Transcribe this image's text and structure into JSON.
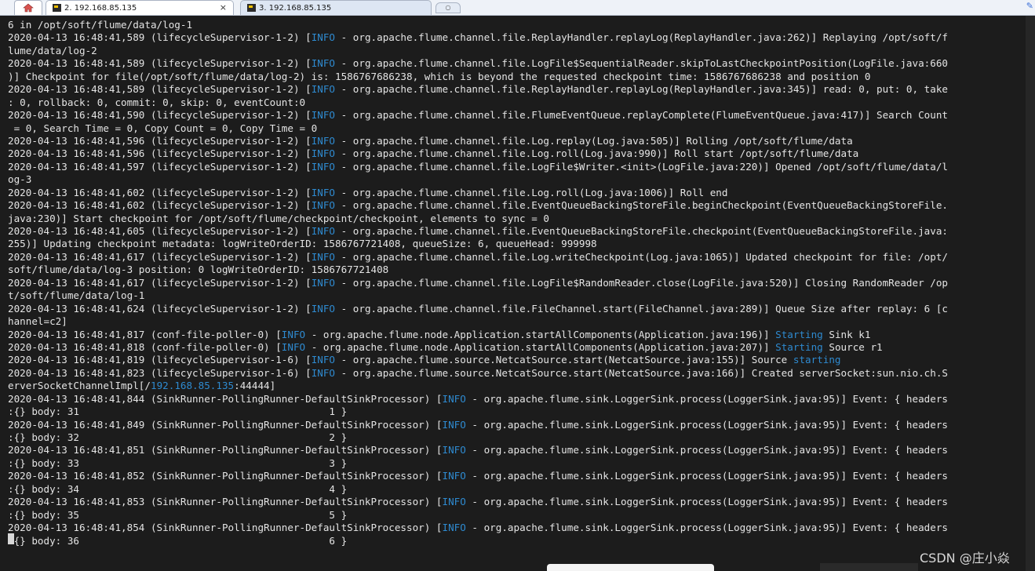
{
  "tabs": [
    {
      "label": "2. 192.168.85.135",
      "close": "×",
      "active": true
    },
    {
      "label": "3. 192.168.85.135",
      "active": false
    }
  ],
  "new_tab_label": "○",
  "icons": {
    "home": "home-icon",
    "session": "terminal-session-icon",
    "corner": "pin-icon"
  },
  "colors": {
    "background": "#1c1c1c",
    "text": "#e4e4e4",
    "highlight": "#2e8ad0"
  },
  "terminal_lines": [
    [
      {
        "t": "6 in /opt/soft/flume/data/log-1"
      }
    ],
    [
      {
        "t": "2020-04-13 16:48:41,589 (lifecycleSupervisor-1-2) ["
      },
      {
        "t": "INFO",
        "c": "hl"
      },
      {
        "t": " - org.apache.flume.channel.file.ReplayHandler.replayLog(ReplayHandler.java:262)] Replaying /opt/soft/f"
      }
    ],
    [
      {
        "t": "lume/data/log-2"
      }
    ],
    [
      {
        "t": "2020-04-13 16:48:41,589 (lifecycleSupervisor-1-2) ["
      },
      {
        "t": "INFO",
        "c": "hl"
      },
      {
        "t": " - org.apache.flume.channel.file.LogFile$SequentialReader.skipToLastCheckpointPosition(LogFile.java:660"
      }
    ],
    [
      {
        "t": ")] Checkpoint for file(/opt/soft/flume/data/log-2) is: 1586767686238, which is beyond the requested checkpoint time: 1586767686238 and position 0"
      }
    ],
    [
      {
        "t": "2020-04-13 16:48:41,589 (lifecycleSupervisor-1-2) ["
      },
      {
        "t": "INFO",
        "c": "hl"
      },
      {
        "t": " - org.apache.flume.channel.file.ReplayHandler.replayLog(ReplayHandler.java:345)] read: 0, put: 0, take"
      }
    ],
    [
      {
        "t": ": 0, rollback: 0, commit: 0, skip: 0, eventCount:0"
      }
    ],
    [
      {
        "t": "2020-04-13 16:48:41,590 (lifecycleSupervisor-1-2) ["
      },
      {
        "t": "INFO",
        "c": "hl"
      },
      {
        "t": " - org.apache.flume.channel.file.FlumeEventQueue.replayComplete(FlumeEventQueue.java:417)] Search Count"
      }
    ],
    [
      {
        "t": " = 0, Search Time = 0, Copy Count = 0, Copy Time = 0"
      }
    ],
    [
      {
        "t": "2020-04-13 16:48:41,596 (lifecycleSupervisor-1-2) ["
      },
      {
        "t": "INFO",
        "c": "hl"
      },
      {
        "t": " - org.apache.flume.channel.file.Log.replay(Log.java:505)] Rolling /opt/soft/flume/data"
      }
    ],
    [
      {
        "t": "2020-04-13 16:48:41,596 (lifecycleSupervisor-1-2) ["
      },
      {
        "t": "INFO",
        "c": "hl"
      },
      {
        "t": " - org.apache.flume.channel.file.Log.roll(Log.java:990)] Roll start /opt/soft/flume/data"
      }
    ],
    [
      {
        "t": "2020-04-13 16:48:41,597 (lifecycleSupervisor-1-2) ["
      },
      {
        "t": "INFO",
        "c": "hl"
      },
      {
        "t": " - org.apache.flume.channel.file.LogFile$Writer.<init>(LogFile.java:220)] Opened /opt/soft/flume/data/l"
      }
    ],
    [
      {
        "t": "og-3"
      }
    ],
    [
      {
        "t": "2020-04-13 16:48:41,602 (lifecycleSupervisor-1-2) ["
      },
      {
        "t": "INFO",
        "c": "hl"
      },
      {
        "t": " - org.apache.flume.channel.file.Log.roll(Log.java:1006)] Roll end"
      }
    ],
    [
      {
        "t": "2020-04-13 16:48:41,602 (lifecycleSupervisor-1-2) ["
      },
      {
        "t": "INFO",
        "c": "hl"
      },
      {
        "t": " - org.apache.flume.channel.file.EventQueueBackingStoreFile.beginCheckpoint(EventQueueBackingStoreFile."
      }
    ],
    [
      {
        "t": "java:230)] Start checkpoint for /opt/soft/flume/checkpoint/checkpoint, elements to sync = 0"
      }
    ],
    [
      {
        "t": "2020-04-13 16:48:41,605 (lifecycleSupervisor-1-2) ["
      },
      {
        "t": "INFO",
        "c": "hl"
      },
      {
        "t": " - org.apache.flume.channel.file.EventQueueBackingStoreFile.checkpoint(EventQueueBackingStoreFile.java:"
      }
    ],
    [
      {
        "t": "255)] Updating checkpoint metadata: logWriteOrderID: 1586767721408, queueSize: 6, queueHead: 999998"
      }
    ],
    [
      {
        "t": "2020-04-13 16:48:41,617 (lifecycleSupervisor-1-2) ["
      },
      {
        "t": "INFO",
        "c": "hl"
      },
      {
        "t": " - org.apache.flume.channel.file.Log.writeCheckpoint(Log.java:1065)] Updated checkpoint for file: /opt/"
      }
    ],
    [
      {
        "t": "soft/flume/data/log-3 position: 0 logWriteOrderID: 1586767721408"
      }
    ],
    [
      {
        "t": "2020-04-13 16:48:41,617 (lifecycleSupervisor-1-2) ["
      },
      {
        "t": "INFO",
        "c": "hl"
      },
      {
        "t": " - org.apache.flume.channel.file.LogFile$RandomReader.close(LogFile.java:520)] Closing RandomReader /op"
      }
    ],
    [
      {
        "t": "t/soft/flume/data/log-1"
      }
    ],
    [
      {
        "t": "2020-04-13 16:48:41,624 (lifecycleSupervisor-1-2) ["
      },
      {
        "t": "INFO",
        "c": "hl"
      },
      {
        "t": " - org.apache.flume.channel.file.FileChannel.start(FileChannel.java:289)] Queue Size after replay: 6 [c"
      }
    ],
    [
      {
        "t": "hannel=c2]"
      }
    ],
    [
      {
        "t": "2020-04-13 16:48:41,817 (conf-file-poller-0) ["
      },
      {
        "t": "INFO",
        "c": "hl"
      },
      {
        "t": " - org.apache.flume.node.Application.startAllComponents(Application.java:196)] "
      },
      {
        "t": "Starting",
        "c": "hl"
      },
      {
        "t": " Sink k1"
      }
    ],
    [
      {
        "t": "2020-04-13 16:48:41,818 (conf-file-poller-0) ["
      },
      {
        "t": "INFO",
        "c": "hl"
      },
      {
        "t": " - org.apache.flume.node.Application.startAllComponents(Application.java:207)] "
      },
      {
        "t": "Starting",
        "c": "hl"
      },
      {
        "t": " Source r1"
      }
    ],
    [
      {
        "t": "2020-04-13 16:48:41,819 (lifecycleSupervisor-1-6) ["
      },
      {
        "t": "INFO",
        "c": "hl"
      },
      {
        "t": " - org.apache.flume.source.NetcatSource.start(NetcatSource.java:155)] Source "
      },
      {
        "t": "starting",
        "c": "hl"
      }
    ],
    [
      {
        "t": "2020-04-13 16:48:41,823 (lifecycleSupervisor-1-6) ["
      },
      {
        "t": "INFO",
        "c": "hl"
      },
      {
        "t": " - org.apache.flume.source.NetcatSource.start(NetcatSource.java:166)] Created serverSocket:sun.nio.ch.S"
      }
    ],
    [
      {
        "t": "erverSocketChannelImpl[/"
      },
      {
        "t": "192.168.85.135",
        "c": "hl"
      },
      {
        "t": ":44444]"
      }
    ],
    [
      {
        "t": "2020-04-13 16:48:41,844 (SinkRunner-PollingRunner-DefaultSinkProcessor) ["
      },
      {
        "t": "INFO",
        "c": "hl"
      },
      {
        "t": " - org.apache.flume.sink.LoggerSink.process(LoggerSink.java:95)] Event: { headers"
      }
    ],
    [
      {
        "t": ":{} body: 31                                          1 }"
      }
    ],
    [
      {
        "t": "2020-04-13 16:48:41,849 (SinkRunner-PollingRunner-DefaultSinkProcessor) ["
      },
      {
        "t": "INFO",
        "c": "hl"
      },
      {
        "t": " - org.apache.flume.sink.LoggerSink.process(LoggerSink.java:95)] Event: { headers"
      }
    ],
    [
      {
        "t": ":{} body: 32                                          2 }"
      }
    ],
    [
      {
        "t": "2020-04-13 16:48:41,851 (SinkRunner-PollingRunner-DefaultSinkProcessor) ["
      },
      {
        "t": "INFO",
        "c": "hl"
      },
      {
        "t": " - org.apache.flume.sink.LoggerSink.process(LoggerSink.java:95)] Event: { headers"
      }
    ],
    [
      {
        "t": ":{} body: 33                                          3 }"
      }
    ],
    [
      {
        "t": "2020-04-13 16:48:41,852 (SinkRunner-PollingRunner-DefaultSinkProcessor) ["
      },
      {
        "t": "INFO",
        "c": "hl"
      },
      {
        "t": " - org.apache.flume.sink.LoggerSink.process(LoggerSink.java:95)] Event: { headers"
      }
    ],
    [
      {
        "t": ":{} body: 34                                          4 }"
      }
    ],
    [
      {
        "t": "2020-04-13 16:48:41,853 (SinkRunner-PollingRunner-DefaultSinkProcessor) ["
      },
      {
        "t": "INFO",
        "c": "hl"
      },
      {
        "t": " - org.apache.flume.sink.LoggerSink.process(LoggerSink.java:95)] Event: { headers"
      }
    ],
    [
      {
        "t": ":{} body: 35                                          5 }"
      }
    ],
    [
      {
        "t": "2020-04-13 16:48:41,854 (SinkRunner-PollingRunner-DefaultSinkProcessor) ["
      },
      {
        "t": "INFO",
        "c": "hl"
      },
      {
        "t": " - org.apache.flume.sink.LoggerSink.process(LoggerSink.java:95)] Event: { headers"
      }
    ],
    [
      {
        "t": ":{} body: 36                                          6 }"
      }
    ]
  ],
  "watermark": "CSDN @庄小焱"
}
